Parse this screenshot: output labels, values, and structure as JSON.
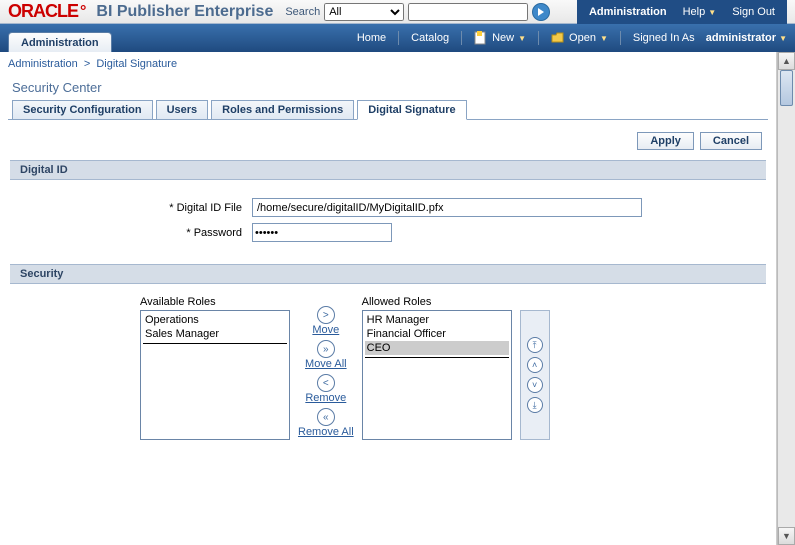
{
  "brand": {
    "oracle": "ORACLE",
    "product": "BI Publisher Enterprise"
  },
  "search": {
    "label": "Search",
    "category": "All",
    "query": ""
  },
  "topnav": {
    "administration": "Administration",
    "help": "Help",
    "signout": "Sign Out"
  },
  "menubar": {
    "home": "Home",
    "catalog": "Catalog",
    "new": "New",
    "open": "Open",
    "signed_in_as": "Signed In As",
    "user": "administrator"
  },
  "admin_tab": "Administration",
  "breadcrumb": {
    "root": "Administration",
    "current": "Digital Signature"
  },
  "page_title": "Security Center",
  "tabs": {
    "cfg": "Security Configuration",
    "users": "Users",
    "roles": "Roles and Permissions",
    "dsig": "Digital Signature"
  },
  "buttons": {
    "apply": "Apply",
    "cancel": "Cancel"
  },
  "sections": {
    "digital_id": "Digital ID",
    "security": "Security"
  },
  "form": {
    "file_label": "* Digital ID File",
    "file_value": "/home/secure/digitalID/MyDigitalID.pfx",
    "pwd_label": "* Password",
    "pwd_value": "••••••"
  },
  "shuttle": {
    "available_title": "Available Roles",
    "allowed_title": "Allowed Roles",
    "available": {
      "0": "Operations",
      "1": "Sales Manager"
    },
    "allowed": {
      "0": "HR Manager",
      "1": "Financial Officer",
      "2": "CEO"
    },
    "controls": {
      "move": "Move",
      "move_all": "Move All",
      "remove": "Remove",
      "remove_all": "Remove All"
    }
  }
}
